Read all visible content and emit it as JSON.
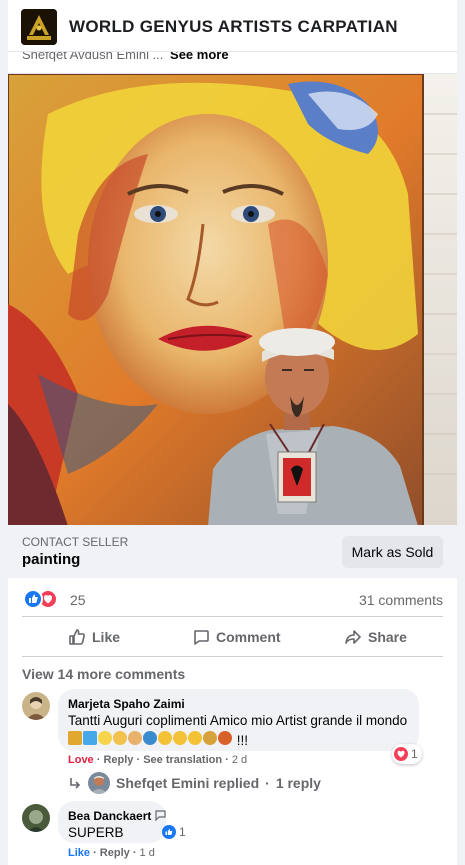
{
  "group": {
    "name": "WORLD GENYUS ARTISTS CARPATIAN"
  },
  "post": {
    "caption_author": "Shefqet Avdush Emini ...",
    "see_more": "See more"
  },
  "listing": {
    "contact_label": "CONTACT SELLER",
    "item_title": "painting",
    "mark_sold_label": "Mark as Sold"
  },
  "engagement": {
    "reaction_count": "25",
    "comment_count": "31 comments",
    "like_label": "Like",
    "comment_label": "Comment",
    "share_label": "Share"
  },
  "comments": {
    "view_more": "View 14 more comments",
    "items": [
      {
        "author": "Marjeta Spaho Zaimi",
        "text": "Tantti Auguri coplimenti Amico mio Artist grande il mondo",
        "emoji_text": "!!!",
        "reaction": "Love",
        "reply": "Reply",
        "translation": "See translation",
        "time": "2 d",
        "reaction_count": "1",
        "replied_author": "Shefqet Emini replied",
        "replies": "1 reply"
      },
      {
        "author": "Bea Danckaert",
        "text": "SUPERB",
        "reaction": "Like",
        "reply": "Reply",
        "time": "1 d",
        "reaction_count": "1"
      }
    ]
  },
  "colors": {
    "like_blue": "#1877f2",
    "love_red": "#e41e3f",
    "secondary_text": "#65676b",
    "bubble_bg": "#f0f2f5"
  }
}
